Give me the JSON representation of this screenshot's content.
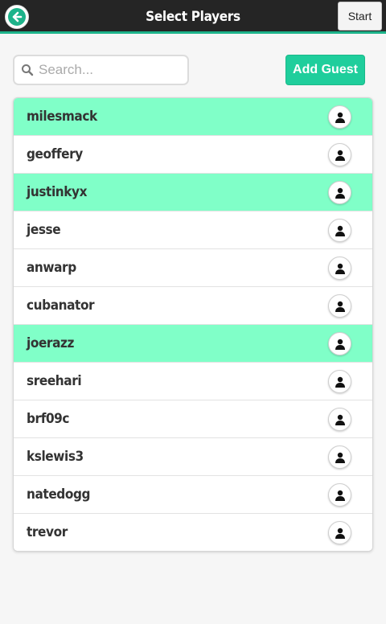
{
  "header": {
    "title": "Select Players",
    "start_label": "Start",
    "back_icon": "arrow-left-circle-icon"
  },
  "search": {
    "placeholder": "Search...",
    "value": ""
  },
  "add_guest_label": "Add Guest",
  "colors": {
    "accent": "#1fce9c",
    "selected_row": "#80ffc8",
    "header_bg": "#252525"
  },
  "players": [
    {
      "name": "milesmack",
      "selected": true
    },
    {
      "name": "geoffery",
      "selected": false
    },
    {
      "name": "justinkyx",
      "selected": true
    },
    {
      "name": "jesse",
      "selected": false
    },
    {
      "name": "anwarp",
      "selected": false
    },
    {
      "name": "cubanator",
      "selected": false
    },
    {
      "name": "joerazz",
      "selected": true
    },
    {
      "name": "sreehari",
      "selected": false
    },
    {
      "name": "brf09c",
      "selected": false
    },
    {
      "name": "kslewis3",
      "selected": false
    },
    {
      "name": "natedogg",
      "selected": false
    },
    {
      "name": "trevor",
      "selected": false
    }
  ]
}
